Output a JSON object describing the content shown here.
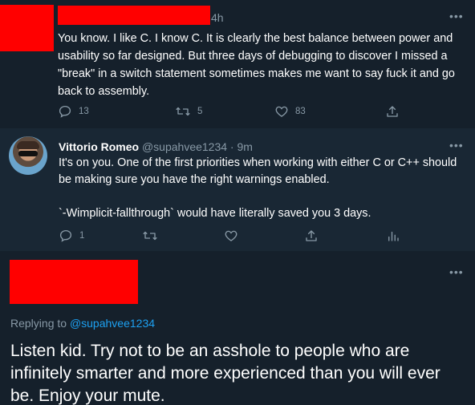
{
  "colors": {
    "background": "#15202b",
    "reply_background": "#192734",
    "secondary_text": "#8899a6",
    "link": "#1da1f2",
    "redaction": "#ff0000"
  },
  "tweet1": {
    "time": "4h",
    "more_icon": "more-icon",
    "text": "You know. I like C. I know C. It is clearly the best balance between power and usability so far designed. But three days of debugging to discover I missed a \"break\" in a switch statement sometimes makes me want to say fuck it and go back to assembly.",
    "actions": {
      "reply_count": "13",
      "retweet_count": "5",
      "like_count": "83"
    }
  },
  "tweet2": {
    "name": "Vittorio Romeo",
    "handle_time": "@supahvee1234 · 9m",
    "text_1": "It's on you. One of the first priorities when working with either C or C++ should be making sure you have the right warnings enabled.",
    "text_2": "`-Wimplicit-fallthrough` would have literally saved you 3 days.",
    "actions": {
      "reply_count": "1"
    }
  },
  "tweet3": {
    "replying_prefix": "Replying to",
    "replying_handle": "@supahvee1234",
    "text": "Listen kid. Try not to be an asshole to people who are infinitely smarter and more experienced than you will ever be. Enjoy your mute."
  }
}
